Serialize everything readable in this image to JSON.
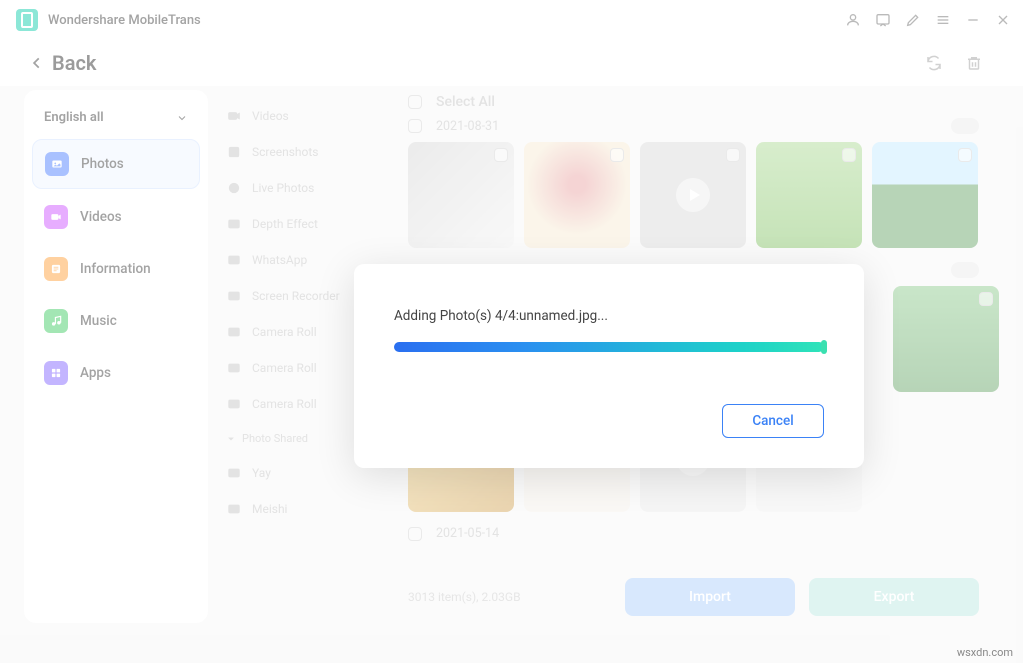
{
  "app": {
    "title": "Wondershare MobileTrans"
  },
  "back": {
    "label": "Back"
  },
  "sidebar": {
    "dropdown": "English all",
    "categories": [
      {
        "label": "Photos",
        "color": "#4277ff"
      },
      {
        "label": "Videos",
        "color": "#c94bff"
      },
      {
        "label": "Information",
        "color": "#ff9a2e"
      },
      {
        "label": "Music",
        "color": "#34c759"
      },
      {
        "label": "Apps",
        "color": "#7a5cff"
      }
    ]
  },
  "albums": [
    "Videos",
    "Screenshots",
    "Live Photos",
    "Depth Effect",
    "WhatsApp",
    "Screen Recorder",
    "Camera Roll",
    "Camera Roll",
    "Camera Roll"
  ],
  "album_section": "Photo Shared",
  "albums2": [
    "Yay",
    "Meishi"
  ],
  "content": {
    "select_all": "Select All",
    "date1": "2021-08-31",
    "date2": "2021-05-14",
    "stats": "3013 item(s), 2.03GB",
    "import": "Import",
    "export": "Export"
  },
  "dialog": {
    "message": "Adding Photo(s) 4/4:unnamed.jpg...",
    "cancel": "Cancel"
  },
  "watermark": "wsxdn.com"
}
